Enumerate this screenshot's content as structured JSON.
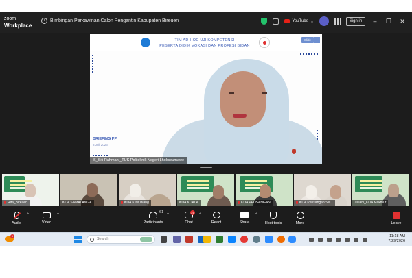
{
  "titlebar": {
    "brand_line1": "zoom",
    "brand_line2": "Workplace",
    "meeting_title": "Bimbingan Perkawinan Calon Pengantin Kabupaten Bireuen",
    "youtube_label": "YouTube",
    "sign_in_label": "Sign in"
  },
  "stage": {
    "slide_title_1": "TIM AD HOC UJI KOMPETENSI",
    "slide_title_2": "PESERTA DIDIK VOKASI DAN PROFESI BIDAN",
    "slide_button": "Slide",
    "briefing": "BRIEFING PP",
    "briefing_date": "8 Juli 2026",
    "speaker_name": "S_Siti Rahmah _TUK Politeknik Negeri Lhokseumawe"
  },
  "thumbnails": [
    {
      "name": "Rifa_Bireuen",
      "muted": true
    },
    {
      "name": "KUA SAMALANGA",
      "muted": false
    },
    {
      "name": "KUA Kuta Blang",
      "muted": true
    },
    {
      "name": "KUA KOALA",
      "muted": false
    },
    {
      "name": "KUA PEUSANGAN",
      "muted": true
    },
    {
      "name": "KUA Peusangan Sel...",
      "muted": true
    },
    {
      "name": "Juliani_KUA Makmur",
      "muted": false
    }
  ],
  "toolbar": {
    "audio": "Audio",
    "video": "Video",
    "participants": "Participants",
    "participants_count": "61",
    "chat": "Chat",
    "chat_badge": "21",
    "react": "React",
    "share": "Share",
    "host_tools": "Host tools",
    "more": "More",
    "leave": "Leave"
  },
  "taskbar": {
    "search_placeholder": "Search",
    "weather_badge": "1",
    "time": "11:18 AM",
    "date": "7/29/2026"
  },
  "colors": {
    "zoom_bg": "#1c1c1c",
    "accent_blue": "#3b5bb5",
    "leave_red": "#e03131",
    "taskbar_bg": "#e4ebf4"
  }
}
